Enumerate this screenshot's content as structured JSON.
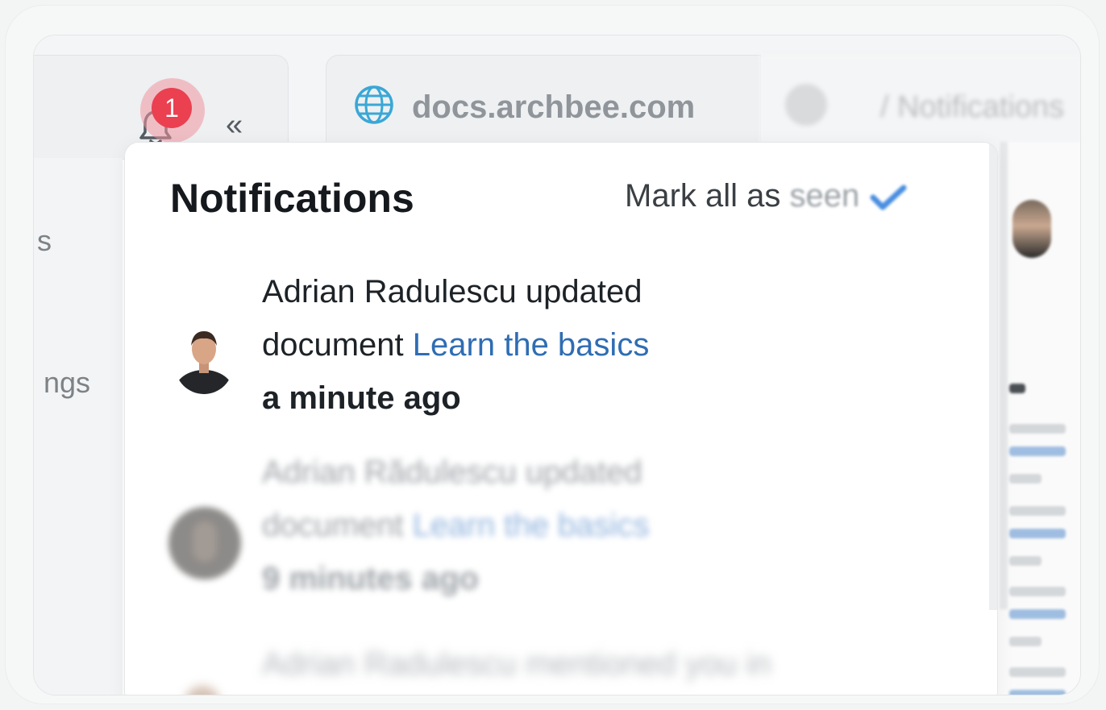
{
  "header": {
    "notification_count": "1",
    "url": "docs.archbee.com",
    "breadcrumb": "/ Notifications"
  },
  "sidebar": {
    "items": [
      {
        "label": "s"
      },
      {
        "label": "ngs"
      }
    ]
  },
  "popover": {
    "title": "Notifications",
    "mark_all_prefix": "Mark all as",
    "mark_all_suffix": "seen"
  },
  "notifications": [
    {
      "actor": "Adrian Radulescu",
      "action": "updated",
      "object_type": "document",
      "link_text": "Learn the basics",
      "time": "a minute ago"
    },
    {
      "actor": "Adrian Rădulescu",
      "action": "updated",
      "object_type": "document",
      "link_text": "Learn the basics",
      "time": "9 minutes ago"
    },
    {
      "actor": "Adrian Radulescu",
      "action": "mentioned you in",
      "object_type": "",
      "link_text": "",
      "time": ""
    }
  ],
  "colors": {
    "badge": "#ea4050",
    "link": "#2f6db3",
    "globe": "#3aa7d6",
    "check": "#4a8ee0"
  }
}
